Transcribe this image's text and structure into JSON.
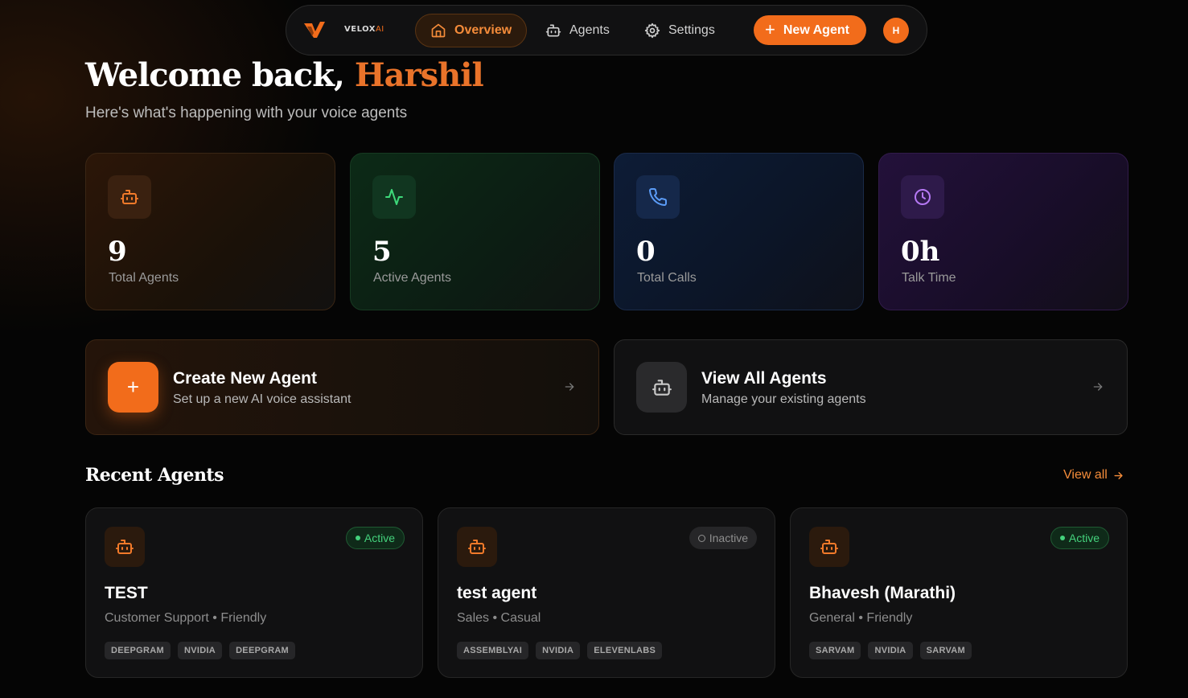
{
  "brand": {
    "logo_text_a": "VELOX",
    "logo_text_b": "AI"
  },
  "nav": {
    "items": [
      {
        "label": "Overview",
        "icon": "home-icon",
        "active": true
      },
      {
        "label": "Agents",
        "icon": "bot-icon",
        "active": false
      },
      {
        "label": "Settings",
        "icon": "gear-icon",
        "active": false
      }
    ],
    "new_agent_label": "New Agent",
    "avatar_initial": "H"
  },
  "header": {
    "welcome_prefix": "Welcome back,",
    "user_name": "Harshil",
    "subtitle": "Here's what's happening with your voice agents"
  },
  "stats": [
    {
      "value": "9",
      "label": "Total Agents",
      "icon": "bot-icon"
    },
    {
      "value": "5",
      "label": "Active Agents",
      "icon": "activity-icon"
    },
    {
      "value": "0",
      "label": "Total Calls",
      "icon": "phone-icon"
    },
    {
      "value": "0h",
      "label": "Talk Time",
      "icon": "clock-icon"
    }
  ],
  "actions": [
    {
      "title": "Create New Agent",
      "description": "Set up a new AI voice assistant",
      "icon": "plus-icon"
    },
    {
      "title": "View All Agents",
      "description": "Manage your existing agents",
      "icon": "bot-icon"
    }
  ],
  "recent": {
    "title": "Recent Agents",
    "view_all_label": "View all",
    "agents": [
      {
        "name": "TEST",
        "category": "Customer Support",
        "tone": "Friendly",
        "meta": "Customer Support • Friendly",
        "status": "Active",
        "tags": [
          "DEEPGRAM",
          "NVIDIA",
          "DEEPGRAM"
        ]
      },
      {
        "name": "test agent",
        "category": "Sales",
        "tone": "Casual",
        "meta": "Sales • Casual",
        "status": "Inactive",
        "tags": [
          "ASSEMBLYAI",
          "NVIDIA",
          "ELEVENLABS"
        ]
      },
      {
        "name": "Bhavesh (Marathi)",
        "category": "General",
        "tone": "Friendly",
        "meta": "General • Friendly",
        "status": "Active",
        "tags": [
          "SARVAM",
          "NVIDIA",
          "SARVAM"
        ]
      }
    ]
  },
  "colors": {
    "accent": "#f26c1b",
    "active": "#44d27c",
    "green_stat": "#3ed97a",
    "blue_stat": "#5b9cf7",
    "purple_stat": "#b679f5"
  }
}
